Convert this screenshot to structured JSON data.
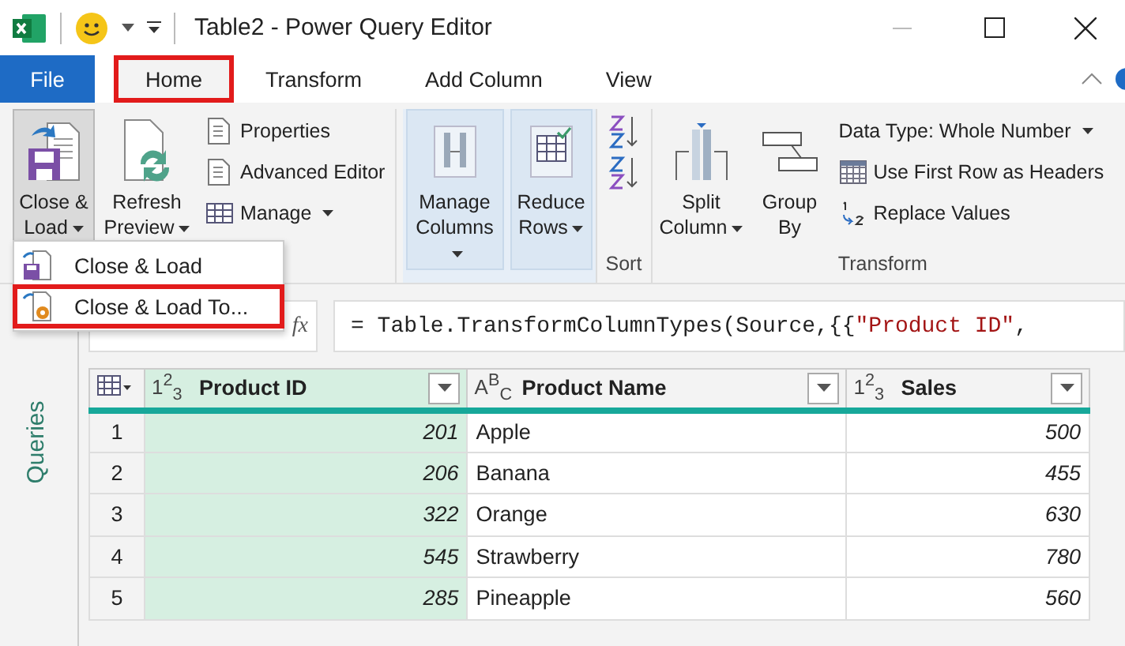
{
  "window": {
    "title": "Table2 - Power Query Editor"
  },
  "tabs": [
    {
      "label": "File",
      "kind": "file",
      "selected": false,
      "highlighted": false
    },
    {
      "label": "Home",
      "kind": "tab",
      "selected": true,
      "highlighted": true
    },
    {
      "label": "Transform",
      "kind": "tab",
      "selected": false,
      "highlighted": false
    },
    {
      "label": "Add Column",
      "kind": "tab",
      "selected": false,
      "highlighted": false
    },
    {
      "label": "View",
      "kind": "tab",
      "selected": false,
      "highlighted": false
    }
  ],
  "ribbon": {
    "close_load": {
      "label": "Close & Load",
      "pressed": true,
      "dropdown": true
    },
    "refresh": {
      "label": "Refresh Preview",
      "dropdown": true
    },
    "query_items": [
      {
        "label": "Properties",
        "dropdown": false
      },
      {
        "label": "Advanced Editor",
        "dropdown": false
      },
      {
        "label": "Manage",
        "dropdown": true
      }
    ],
    "manage_columns": {
      "label": "Manage Columns",
      "dropdown": true
    },
    "reduce_rows": {
      "label": "Reduce Rows",
      "dropdown": true
    },
    "sort": {
      "label": "Sort"
    },
    "split": {
      "label": "Split Column",
      "dropdown": true
    },
    "group_by": {
      "label": "Group By",
      "dropdown": false
    },
    "transform_items": [
      {
        "label": "Data Type: Whole Number",
        "dropdown": true
      },
      {
        "label": "Use First Row as Headers",
        "dropdown": false
      },
      {
        "label": "Replace Values",
        "dropdown": false
      }
    ],
    "transform_label": "Transform"
  },
  "menu": {
    "items": [
      {
        "label": "Close & Load",
        "highlighted": false
      },
      {
        "label": "Close & Load To...",
        "highlighted": true
      }
    ]
  },
  "sidebar": {
    "title": "Queries"
  },
  "formula_bar": {
    "fx": "fx",
    "parts": [
      {
        "kind": "code",
        "text": "= Table.TransformColumnTypes(Source,{{"
      },
      {
        "kind": "string",
        "text": "\"Product ID\""
      },
      {
        "kind": "code",
        "text": ","
      }
    ]
  },
  "table": {
    "columns": [
      {
        "name": "Product ID",
        "type": "1$^{2}$$_{3}$",
        "selected": true
      },
      {
        "name": "Product Name",
        "type": "A$^{B}$$_{C}$",
        "selected": false
      },
      {
        "name": "Sales",
        "type": "1$^{2}$$_{3}$",
        "selected": false
      }
    ],
    "rows": [
      {
        "index": "1",
        "cells": [
          "201",
          "Apple",
          "500"
        ]
      },
      {
        "index": "2",
        "cells": [
          "206",
          "Banana",
          "455"
        ]
      },
      {
        "index": "3",
        "cells": [
          "322",
          "Orange",
          "630"
        ]
      },
      {
        "index": "4",
        "cells": [
          "545",
          "Strawberry",
          "780"
        ]
      },
      {
        "index": "5",
        "cells": [
          "285",
          "Pineapple",
          "560"
        ]
      }
    ]
  }
}
